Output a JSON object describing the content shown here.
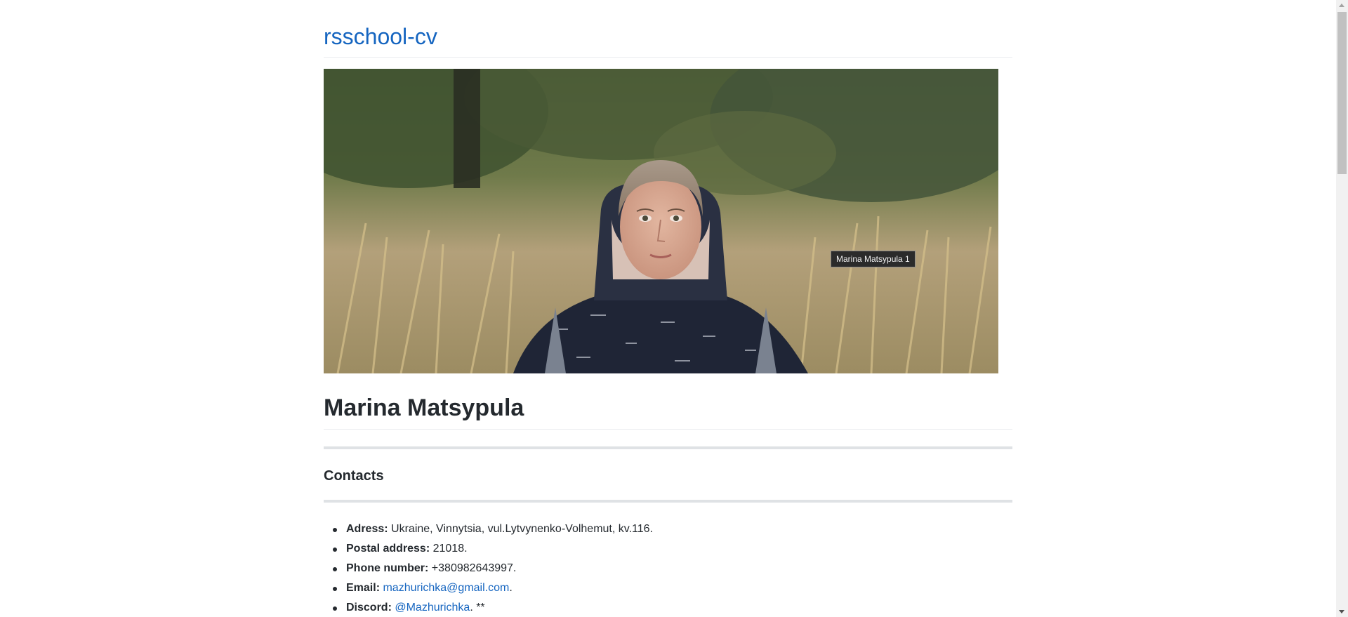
{
  "site": {
    "title": "rsschool-cv"
  },
  "photo": {
    "alt": "Marina Matsypula 1",
    "tooltip": "Marina Matsypula 1"
  },
  "profile": {
    "name": "Marina Matsypula"
  },
  "contacts": {
    "heading": "Contacts",
    "items": [
      {
        "label": "Adress:",
        "value": "Ukraine, Vinnytsia, vul.Lytvynenko-Volhemut, kv.116."
      },
      {
        "label": "Postal address:",
        "value": "21018."
      },
      {
        "label": "Phone number:",
        "value": "+380982643997."
      },
      {
        "label": "Email:",
        "link": "mazhurichka@gmail.com",
        "after": "."
      },
      {
        "label": "Discord:",
        "link": "@Mazhurichka",
        "after": ". **"
      }
    ]
  },
  "colors": {
    "link": "#1565c0",
    "text": "#24292e",
    "rule": "#eaecef"
  }
}
